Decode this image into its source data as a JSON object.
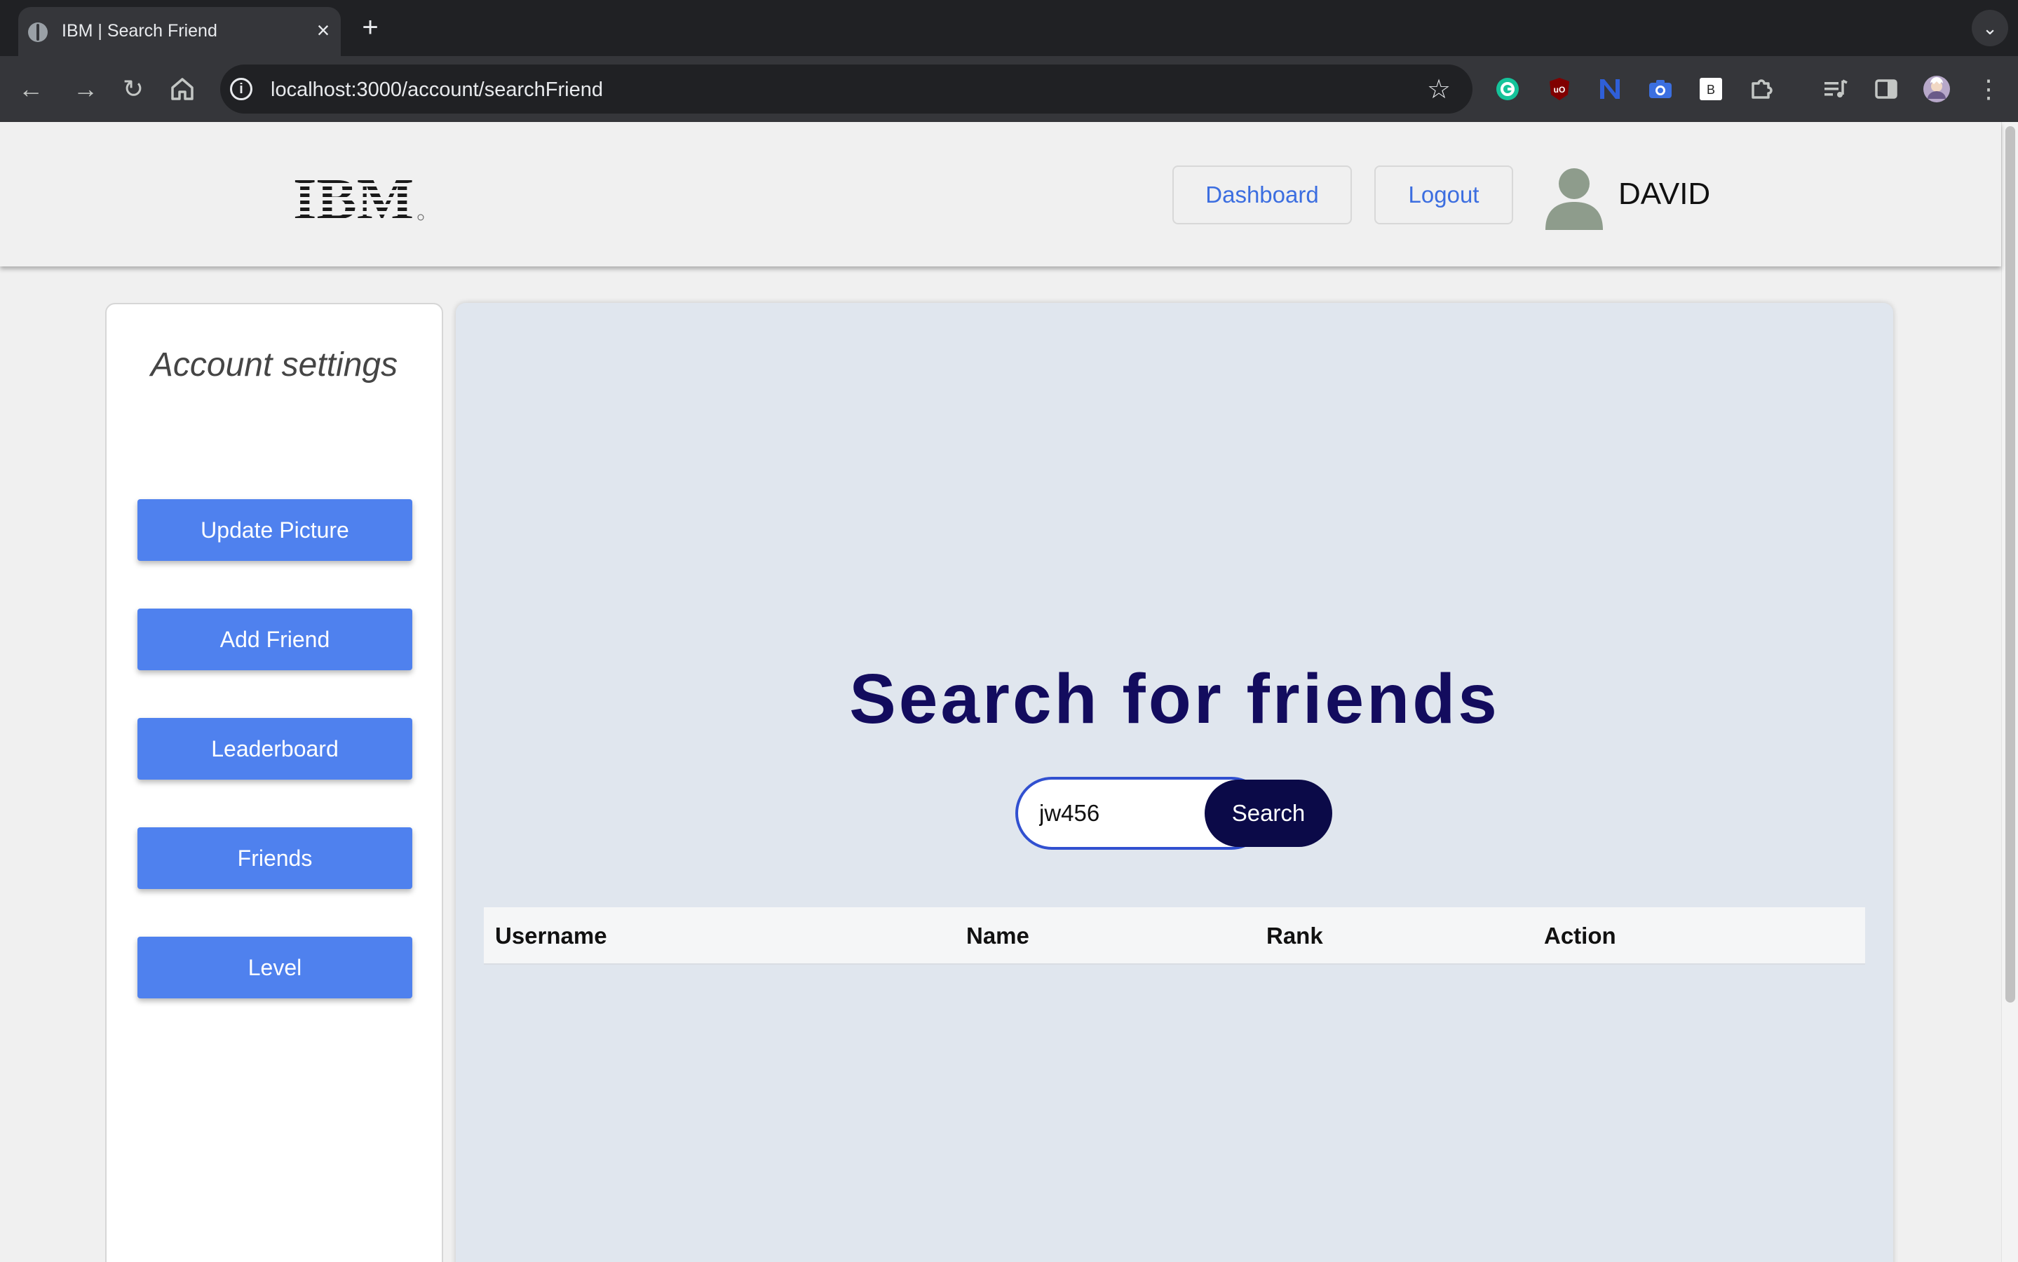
{
  "browser": {
    "tab_title": "IBM | Search Friend",
    "url": "localhost:3000/account/searchFriend",
    "extension_badge": "B"
  },
  "header": {
    "logo_text": "IBM",
    "dashboard_label": "Dashboard",
    "logout_label": "Logout",
    "username": "DAVID"
  },
  "sidebar": {
    "title": "Account settings",
    "items": [
      {
        "label": "Update Picture"
      },
      {
        "label": "Add Friend"
      },
      {
        "label": "Leaderboard"
      },
      {
        "label": "Friends"
      },
      {
        "label": "Level"
      }
    ]
  },
  "main": {
    "title": "Search for friends",
    "search_value": "jw456",
    "search_button": "Search",
    "columns": [
      "Username",
      "Name",
      "Rank",
      "Action"
    ]
  },
  "colors": {
    "primary_button": "#4f81ee",
    "title": "#130c5e",
    "search_button": "#0b0a48",
    "link": "#3c6ee0"
  }
}
